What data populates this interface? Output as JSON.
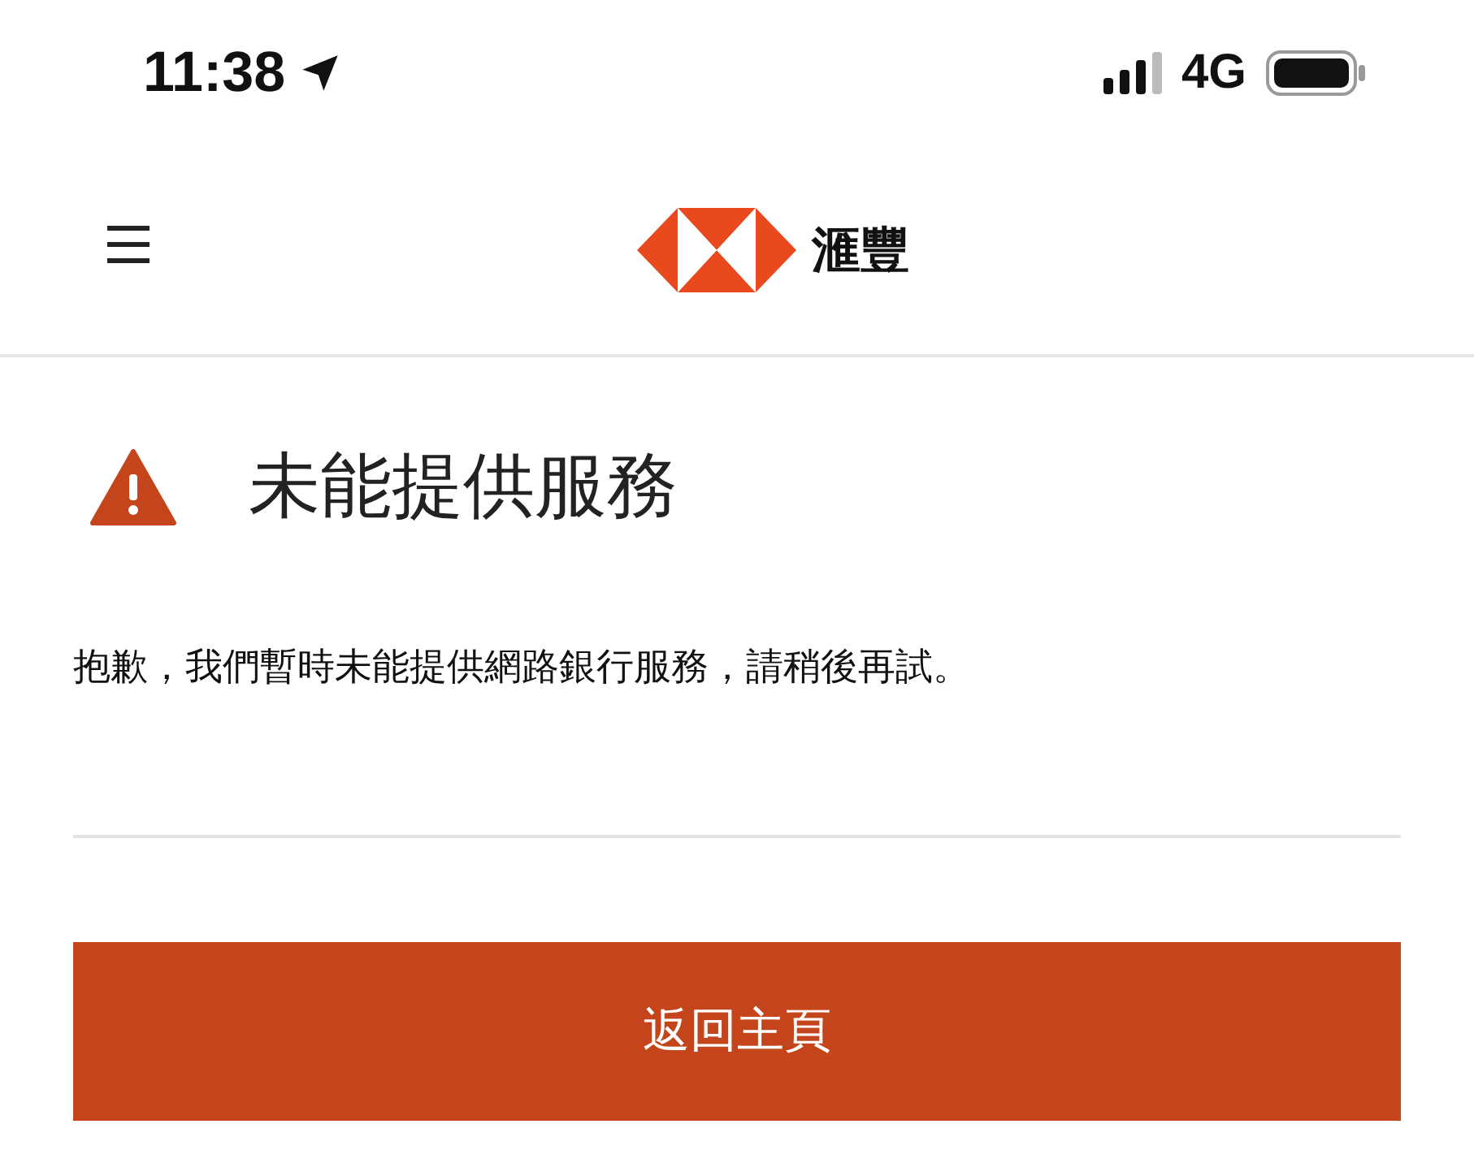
{
  "status_bar": {
    "time": "11:38",
    "network": "4G"
  },
  "header": {
    "brand": "滙豐"
  },
  "notice": {
    "title": "未能提供服務",
    "message": "抱歉，我們暫時未能提供網路銀行服務，請稍後再試。"
  },
  "button": {
    "label": "返回主頁"
  }
}
